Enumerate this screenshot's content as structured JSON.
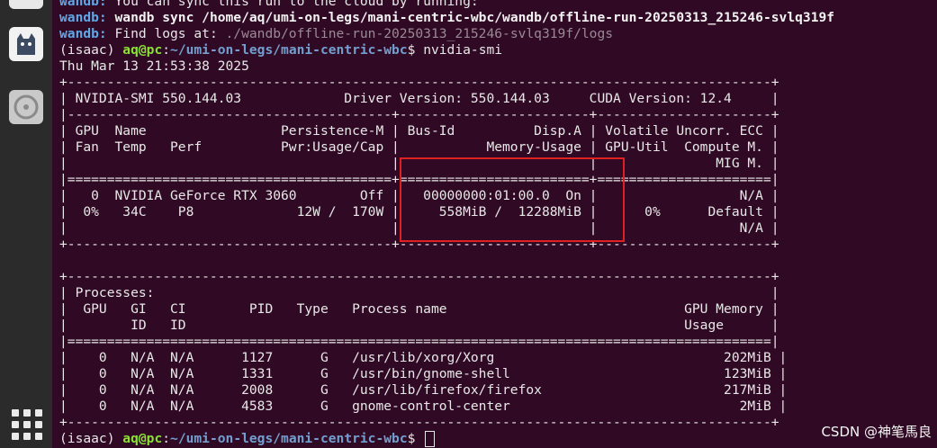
{
  "dock": {
    "icons": [
      "terminal-icon",
      "cat-app-icon",
      "disk-icon",
      "apps-grid-icon"
    ]
  },
  "wandb": {
    "prefix": "wandb:",
    "line1": " You can sync this run to the cloud by running:",
    "line2": " wandb sync /home/aq/umi-on-legs/mani-centric-wbc/wandb/offline-run-20250313_215246-svlq319f",
    "line3_text": " Find logs at: ",
    "line3_path": "./wandb/offline-run-20250313_215246-svlq319f/logs"
  },
  "prompt": {
    "env": "(isaac) ",
    "user": "aq@pc",
    "sep": ":",
    "path": "~/umi-on-legs/mani-centric-wbc",
    "dollar": "$ ",
    "command": "nvidia-smi"
  },
  "timestamp": "Thu Mar 13 21:53:38 2025",
  "smi_table": [
    "+-----------------------------------------------------------------------------------------+",
    "| NVIDIA-SMI 550.144.03             Driver Version: 550.144.03     CUDA Version: 12.4     |",
    "|-----------------------------------------+------------------------+----------------------+",
    "| GPU  Name                 Persistence-M | Bus-Id          Disp.A | Volatile Uncorr. ECC |",
    "| Fan  Temp   Perf          Pwr:Usage/Cap |           Memory-Usage | GPU-Util  Compute M. |",
    "|                                         |                        |               MIG M. |",
    "|=========================================+========================+======================|",
    "|   0  NVIDIA GeForce RTX 3060        Off |   00000000:01:00.0  On |                  N/A |",
    "|  0%   34C    P8             12W /  170W |     558MiB /  12288MiB |      0%      Default |",
    "|                                         |                        |                  N/A |",
    "+-----------------------------------------+------------------------+----------------------+",
    "",
    "+-----------------------------------------------------------------------------------------+",
    "| Processes:                                                                              |",
    "|  GPU   GI   CI        PID   Type   Process name                              GPU Memory |",
    "|        ID   ID                                                               Usage      |",
    "|=========================================================================================|",
    "|    0   N/A  N/A      1127      G   /usr/lib/xorg/Xorg                             202MiB |",
    "|    0   N/A  N/A      1331      G   /usr/bin/gnome-shell                           123MiB |",
    "|    0   N/A  N/A      2008      G   /usr/lib/firefox/firefox                       217MiB |",
    "|    0   N/A  N/A      4583      G   gnome-control-center                             2MiB |",
    "+-----------------------------------------------------------------------------------------+"
  ],
  "watermark": "CSDN @神笔馬良",
  "colors": {
    "background": "#300a24",
    "wandb": "#5fa8e8",
    "prompt_user": "#8ae234",
    "prompt_path": "#729fcf",
    "highlight_box": "#e02020"
  }
}
